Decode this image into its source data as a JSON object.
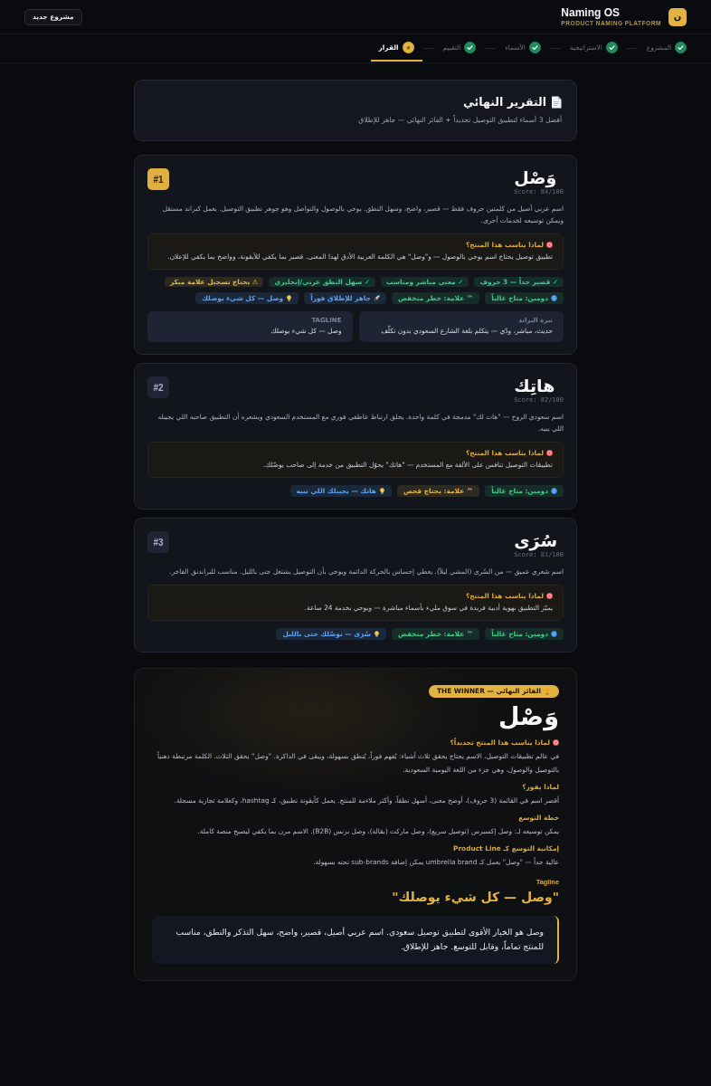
{
  "header": {
    "logo_letter": "ن",
    "brand": "Naming OS",
    "tagline": "PRODUCT NAMING PLATFORM",
    "new_project_button": "مشروع جديد"
  },
  "steps": [
    {
      "label": "المشروع",
      "done": true,
      "selected": false
    },
    {
      "label": "الاستراتيجية",
      "done": true,
      "selected": false
    },
    {
      "label": "الأسماء",
      "done": true,
      "selected": false
    },
    {
      "label": "التقييم",
      "done": true,
      "selected": false
    },
    {
      "label": "القرار",
      "done": false,
      "selected": true
    }
  ],
  "report": {
    "title": "التقرير النهائي",
    "subtitle": "أفضل 3 أسماء لتطبيق التوصيل تحديداً + الفائز النهائي — جاهز للإطلاق"
  },
  "candidates": [
    {
      "rank": "#1",
      "winner": true,
      "name": "وَصْل",
      "score": "Score: 84/100",
      "description": "اسم عربي أصيل من كلمتين حروف فقط — قصير، واضح، وسهل النطق. يوحي بالوصول والتواصل وهو جوهر تطبيق التوصيل. يعمل كبراند مستقل ويمكن توسيعه لخدمات أخرى.",
      "why": {
        "title": "لماذا يناسب هذا المنتج؟",
        "text": "تطبيق توصيل يحتاج اسم يوحي بالوصول — و\"وصل\" هي الكلمة العربية الأدق لهذا المعنى. قصير بما يكفي للأيقونة، وواضح بما يكفي للإعلان."
      },
      "traits": [
        {
          "text": "✓ قصير جداً — 3 حروف",
          "color": "#3fc88a"
        },
        {
          "text": "✓ معنى مباشر ومناسب",
          "color": "#3fc88a"
        },
        {
          "text": "✓ سهل النطق عربي/إنجليزي",
          "color": "#3fc88a"
        },
        {
          "text": "⚠ يحتاج تسجيل علامة مبكر",
          "color": "#e3b341"
        }
      ],
      "badges": [
        {
          "kind": "domain",
          "text": "دومين: متاح غالباً",
          "color": "#3fc88a"
        },
        {
          "kind": "trademark",
          "text": "™ علامة: خطر منخفض",
          "color": "#3fc88a"
        },
        {
          "kind": "launch",
          "text": "جاهز للإطلاق فوراً",
          "color": "#5aa2f5"
        },
        {
          "kind": "tagline",
          "text": "وصل — كل شيء يوصلك",
          "color": "#5aa2f5"
        }
      ],
      "details": [
        {
          "label": "نبرة البراند",
          "text": "حديث، مباشر، ودّي — يتكلم بلغة الشارع السعودي بدون تكلّف"
        },
        {
          "label": "TAGLINE",
          "text": "وصل — كل شيء يوصلك"
        }
      ]
    },
    {
      "rank": "#2",
      "winner": false,
      "name": "هاتِك",
      "score": "Score: 82/100",
      "description": "اسم سعودي الروح — \"هات لك\" مدمجة في كلمة واحدة. يخلق ارتباط عاطفي فوري مع المستخدم السعودي ويشعره أن التطبيق صاحبه اللي يجيبله اللي يبيه.",
      "why": {
        "title": "لماذا يناسب هذا المنتج؟",
        "text": "تطبيقات التوصيل تنافس على الألفة مع المستخدم — \"هاتك\" يحوّل التطبيق من خدمة إلى صاحب يوصّلك."
      },
      "badges": [
        {
          "kind": "domain",
          "text": "دومين: متاح غالباً",
          "color": "#3fc88a"
        },
        {
          "kind": "trademark",
          "text": "™ علامة: يحتاج فحص",
          "color": "#e3b341"
        },
        {
          "kind": "tagline",
          "text": "هاتك — يجيبلك اللي تبيه",
          "color": "#5aa2f5"
        }
      ]
    },
    {
      "rank": "#3",
      "winner": false,
      "name": "سُرَى",
      "score": "Score: 81/100",
      "description": "اسم شعري عميق — من السُرى (المشي ليلاً). يعطي إحساس بالحركة الدائمة ويوحي بأن التوصيل يشتغل حتى بالليل. مناسب للبراندنق الفاخر.",
      "why": {
        "title": "لماذا يناسب هذا المنتج؟",
        "text": "يميّز التطبيق بهوية أدبية فريدة في سوق مليء بأسماء مباشرة — ويوحي بخدمة 24 ساعة."
      },
      "badges": [
        {
          "kind": "domain",
          "text": "دومين: متاح غالباً",
          "color": "#3fc88a"
        },
        {
          "kind": "trademark",
          "text": "™ علامة: خطر منخفض",
          "color": "#3fc88a"
        },
        {
          "kind": "tagline",
          "text": "سُرَى — نوصّلك حتى بالليل",
          "color": "#5aa2f5"
        }
      ]
    }
  ],
  "winner": {
    "badge": "الفائز النهائي — THE WINNER",
    "name": "وَصْل",
    "sections": [
      {
        "kind": "why",
        "heading": "لماذا يناسب هذا المنتج تحديداً؟",
        "text": "في عالم تطبيقات التوصيل، الاسم يحتاج يحقق ثلاث أشياء: يُفهم فوراً، يُنطق بسهولة، ويبقى في الذاكرة. \"وصل\" يحقق الثلاث. الكلمة مرتبطة ذهنياً بالتوصيل والوصول، وهي جزء من اللغة اليومية السعودية."
      },
      {
        "kind": "plain",
        "heading": "لماذا يفوز؟",
        "text": "أقصر اسم في القائمة (3 حروف)، أوضح معنى، أسهل نطقاً، وأكثر ملاءمة للمنتج. يعمل كأيقونة تطبيق، كـ hashtag، وكعلامة تجارية مسجلة."
      },
      {
        "kind": "plain",
        "heading": "خطة التوسع",
        "text": "يمكن توسيعه لـ: وصل إكسبرس (توصيل سريع)، وصل ماركت (بقالة)، وصل بزنس (B2B). الاسم مرن بما يكفي ليصبح منصة كاملة."
      },
      {
        "kind": "plain",
        "heading": "إمكانية التوسع كـ Product Line",
        "text": "عالية جداً — \"وصل\" يعمل كـ umbrella brand يمكن إضافة sub-brands تحته بسهولة."
      }
    ],
    "tagline_label": "Tagline",
    "tagline": "\"وصل — كل شيء يوصلك\"",
    "verdict": "وصل هو الخيار الأقوى لتطبيق توصيل سعودي. اسم عربي أصيل، قصير، واضح، سهل التذكر والنطق، مناسب للمنتج تماماً، وقابل للتوسع. جاهز للإطلاق."
  }
}
